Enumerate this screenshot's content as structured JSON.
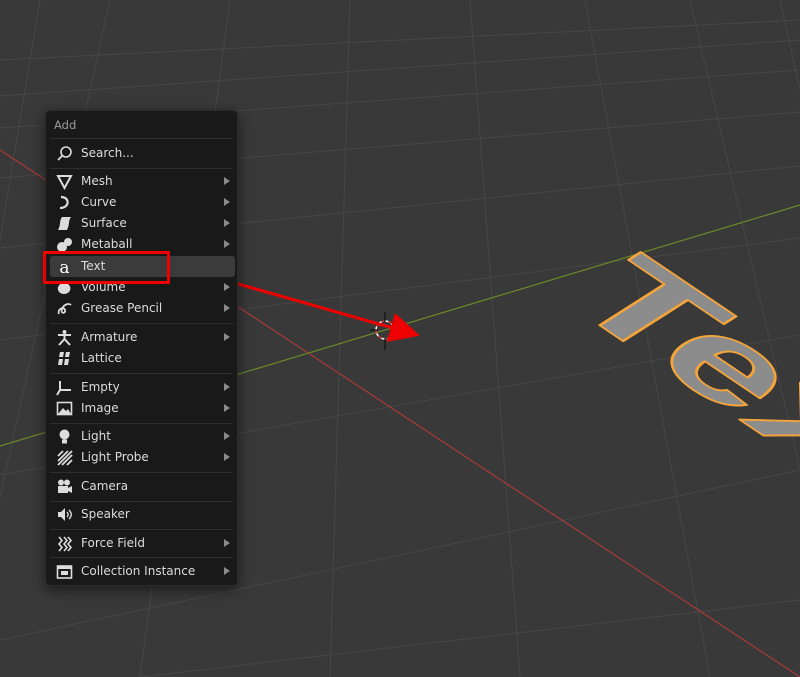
{
  "menu": {
    "title": "Add",
    "items": [
      {
        "label": "Search...",
        "icon": "search-icon",
        "submenu": false
      },
      {
        "label": "Mesh",
        "icon": "mesh-icon",
        "submenu": true
      },
      {
        "label": "Curve",
        "icon": "curve-icon",
        "submenu": true
      },
      {
        "label": "Surface",
        "icon": "surface-icon",
        "submenu": true
      },
      {
        "label": "Metaball",
        "icon": "metaball-icon",
        "submenu": true
      },
      {
        "label": "Text",
        "icon": "text-icon",
        "submenu": false,
        "highlighted": true
      },
      {
        "label": "Volume",
        "icon": "volume-icon",
        "submenu": true
      },
      {
        "label": "Grease Pencil",
        "icon": "grease-pencil-icon",
        "submenu": true
      },
      {
        "label": "Armature",
        "icon": "armature-icon",
        "submenu": true
      },
      {
        "label": "Lattice",
        "icon": "lattice-icon",
        "submenu": false
      },
      {
        "label": "Empty",
        "icon": "empty-icon",
        "submenu": true
      },
      {
        "label": "Image",
        "icon": "image-icon",
        "submenu": true
      },
      {
        "label": "Light",
        "icon": "light-icon",
        "submenu": true
      },
      {
        "label": "Light Probe",
        "icon": "light-probe-icon",
        "submenu": true
      },
      {
        "label": "Camera",
        "icon": "camera-icon",
        "submenu": false
      },
      {
        "label": "Speaker",
        "icon": "speaker-icon",
        "submenu": false
      },
      {
        "label": "Force Field",
        "icon": "force-field-icon",
        "submenu": true
      },
      {
        "label": "Collection Instance",
        "icon": "collection-icon",
        "submenu": true
      }
    ]
  },
  "viewport": {
    "object_text": "Text",
    "colors": {
      "background": "#393939",
      "grid": "#444444",
      "x_axis": "#a83a3a",
      "y_axis": "#6a8a2a",
      "object_fill": "#8c8c8c",
      "selection_outline": "#f5a43a",
      "annotation": "#ee0000"
    }
  }
}
